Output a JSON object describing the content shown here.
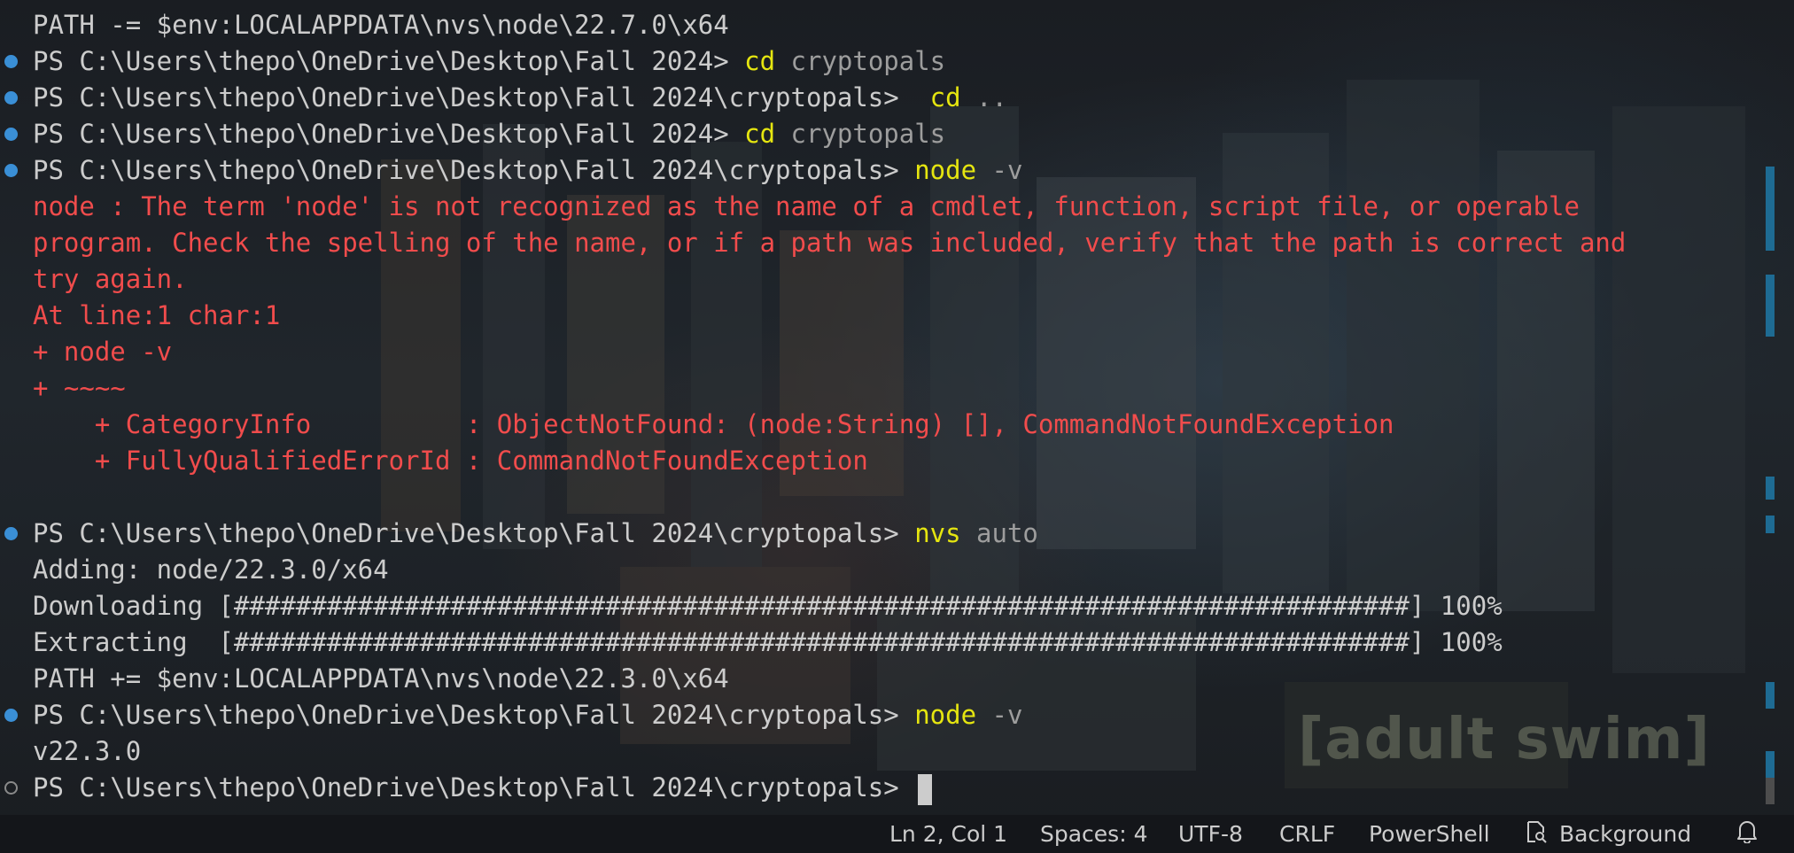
{
  "terminal": {
    "lines": [
      {
        "marker": "none",
        "kind": "plain",
        "text": "PATH -= $env:LOCALAPPDATA\\nvs\\node\\22.7.0\\x64"
      },
      {
        "marker": "dot",
        "kind": "prompt",
        "prompt": "PS C:\\Users\\thepo\\OneDrive\\Desktop\\Fall 2024> ",
        "cmd": "cd",
        "args": " cryptopals"
      },
      {
        "marker": "dot",
        "kind": "prompt",
        "prompt": "PS C:\\Users\\thepo\\OneDrive\\Desktop\\Fall 2024\\cryptopals>  ",
        "cmd": "cd",
        "args": " .."
      },
      {
        "marker": "dot",
        "kind": "prompt",
        "prompt": "PS C:\\Users\\thepo\\OneDrive\\Desktop\\Fall 2024> ",
        "cmd": "cd",
        "args": " cryptopals"
      },
      {
        "marker": "dot",
        "kind": "prompt",
        "prompt": "PS C:\\Users\\thepo\\OneDrive\\Desktop\\Fall 2024\\cryptopals> ",
        "cmd": "node",
        "args": " -v"
      },
      {
        "marker": "none",
        "kind": "error",
        "text": "node : The term 'node' is not recognized as the name of a cmdlet, function, script file, or operable"
      },
      {
        "marker": "none",
        "kind": "error",
        "text": "program. Check the spelling of the name, or if a path was included, verify that the path is correct and"
      },
      {
        "marker": "none",
        "kind": "error",
        "text": "try again."
      },
      {
        "marker": "none",
        "kind": "error",
        "text": "At line:1 char:1"
      },
      {
        "marker": "none",
        "kind": "error",
        "text": "+ node -v"
      },
      {
        "marker": "none",
        "kind": "error",
        "text": "+ ~~~~"
      },
      {
        "marker": "none",
        "kind": "error",
        "text": "    + CategoryInfo          : ObjectNotFound: (node:String) [], CommandNotFoundException"
      },
      {
        "marker": "none",
        "kind": "error",
        "text": "    + FullyQualifiedErrorId : CommandNotFoundException"
      },
      {
        "marker": "none",
        "kind": "plain",
        "text": ""
      },
      {
        "marker": "dot",
        "kind": "prompt",
        "prompt": "PS C:\\Users\\thepo\\OneDrive\\Desktop\\Fall 2024\\cryptopals> ",
        "cmd": "nvs",
        "args": " auto"
      },
      {
        "marker": "none",
        "kind": "plain",
        "text": "Adding: node/22.3.0/x64"
      },
      {
        "marker": "none",
        "kind": "plain",
        "text": "Downloading [############################################################################] 100%"
      },
      {
        "marker": "none",
        "kind": "plain",
        "text": "Extracting  [############################################################################] 100%"
      },
      {
        "marker": "none",
        "kind": "plain",
        "text": "PATH += $env:LOCALAPPDATA\\nvs\\node\\22.3.0\\x64"
      },
      {
        "marker": "dot",
        "kind": "prompt",
        "prompt": "PS C:\\Users\\thepo\\OneDrive\\Desktop\\Fall 2024\\cryptopals> ",
        "cmd": "node",
        "args": " -v"
      },
      {
        "marker": "none",
        "kind": "plain",
        "text": "v22.3.0"
      },
      {
        "marker": "hollow",
        "kind": "current",
        "prompt": "PS C:\\Users\\thepo\\OneDrive\\Desktop\\Fall 2024\\cryptopals> "
      }
    ]
  },
  "status_bar": {
    "position": "Ln 2, Col 1",
    "spaces": "Spaces: 4",
    "encoding": "UTF-8",
    "line_ending": "CRLF",
    "language": "PowerShell",
    "background": "Background",
    "background_icon": "file-search-icon",
    "notifications_icon": "bell-icon"
  },
  "background_image": {
    "watermark": "[adult swim]"
  },
  "colors": {
    "terminal_text": "#cccccc",
    "error": "#f14c4c",
    "command": "#e5e510",
    "argument": "#9d9d9d",
    "command_marker": "#3a8fd6",
    "scrollbar_marker": "#1e6b93"
  }
}
